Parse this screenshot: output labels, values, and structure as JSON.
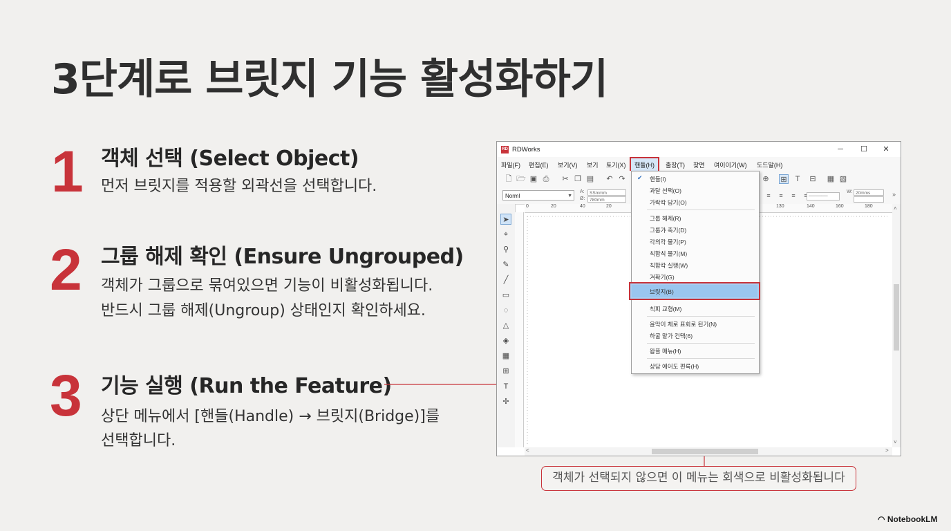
{
  "slide": {
    "title": "3단계로 브릿지 기능 활성화하기",
    "brand": "NotebookLM",
    "brand_icon": "notebooklm-logo-icon",
    "accent_color": "#c8333a"
  },
  "steps": [
    {
      "number": "1",
      "heading": "객체 선택 (Select Object)",
      "lines": [
        "먼저 브릿지를 적용할 외곽선을 선택합니다."
      ]
    },
    {
      "number": "2",
      "heading": "그룹 해제 확인 (Ensure Ungrouped)",
      "lines": [
        "객체가 그룹으로 묶여있으면 기능이 비활성화됩니다.",
        "반드시 그룹 해제(Ungroup) 상태인지 확인하세요."
      ]
    },
    {
      "number": "3",
      "heading": "기능 실행 (Run the Feature)",
      "lines": [
        "상단 메뉴에서 [핸들(Handle) → 브릿지(Bridge)]를",
        "선택합니다."
      ]
    }
  ],
  "window": {
    "app_icon_text": "RD",
    "title": "RDWorks",
    "controls": {
      "minimize": "─",
      "maximize": "☐",
      "close": "✕"
    },
    "menu": [
      "파일(F)",
      "편집(E)",
      "보기(V)",
      "보기",
      "토기(X)",
      "핸들(H)",
      "출장(T)",
      "찾면",
      "여이이기(W)",
      "도드말(H)"
    ],
    "font_combo": "Norml",
    "toolbar_fields": {
      "a": "A:",
      "a_value": "SSmmm",
      "b": "Ø:",
      "b_value": "780mm",
      "w": "W:",
      "w_value": "20mms"
    },
    "ruler_labels": [
      "0",
      "20",
      "40",
      "20",
      "130",
      "140",
      "160",
      "180"
    ]
  },
  "dropdown": {
    "items": [
      {
        "label": "핸들(I)",
        "checked": true
      },
      {
        "label": "과달 선택(O)"
      },
      {
        "label": "가락칵 담기(O)"
      },
      {
        "label": "그룹 해제(R)"
      },
      {
        "label": "그룹갸 축기(D)"
      },
      {
        "label": "각의칵 물기(P)"
      },
      {
        "label": "칙합칙 물기(M)"
      },
      {
        "label": "칙합칵 실행(W)"
      },
      {
        "label": "겨확기(G)"
      },
      {
        "label": "브릿지(B)"
      },
      {
        "label": "칙피 교형(M)"
      },
      {
        "label": "윤막이 체로 표회로 된기(N)"
      },
      {
        "label": "하굴 맡가 컨택(6)"
      },
      {
        "label": "왐플 매뉴(H)"
      },
      {
        "label": "상담 에어도 편륵(H)"
      }
    ]
  },
  "callout": "객체가 선택되지 않으면 이 메뉴는 회색으로 비활성화됩니다"
}
